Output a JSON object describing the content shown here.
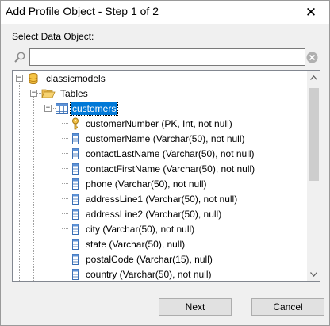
{
  "window": {
    "title": "Add Profile Object - Step 1 of 2",
    "close_glyph": "✕"
  },
  "prompt": "Select Data Object:",
  "search": {
    "value": "",
    "placeholder": ""
  },
  "tree": {
    "root": {
      "label": "classicmodels",
      "icon": "database-icon",
      "expanded": true
    },
    "folder": {
      "label": "Tables",
      "icon": "folder-open-icon",
      "expanded": true
    },
    "table": {
      "label": "customers",
      "icon": "table-icon",
      "expanded": true,
      "selected": true
    },
    "columns": [
      {
        "label": "customerNumber (PK, Int, not null)",
        "icon": "key-icon"
      },
      {
        "label": "customerName (Varchar(50), not null)",
        "icon": "column-icon"
      },
      {
        "label": "contactLastName (Varchar(50), not null)",
        "icon": "column-icon"
      },
      {
        "label": "contactFirstName (Varchar(50), not null)",
        "icon": "column-icon"
      },
      {
        "label": "phone (Varchar(50), not null)",
        "icon": "column-icon"
      },
      {
        "label": "addressLine1 (Varchar(50), not null)",
        "icon": "column-icon"
      },
      {
        "label": "addressLine2 (Varchar(50), null)",
        "icon": "column-icon"
      },
      {
        "label": "city (Varchar(50), not null)",
        "icon": "column-icon"
      },
      {
        "label": "state (Varchar(50), null)",
        "icon": "column-icon"
      },
      {
        "label": "postalCode (Varchar(15), null)",
        "icon": "column-icon"
      },
      {
        "label": "country (Varchar(50), not null)",
        "icon": "column-icon"
      }
    ]
  },
  "buttons": {
    "next": "Next",
    "cancel": "Cancel"
  },
  "colors": {
    "selection": "#0078d7",
    "dialog_bg": "#f0f0f0"
  }
}
